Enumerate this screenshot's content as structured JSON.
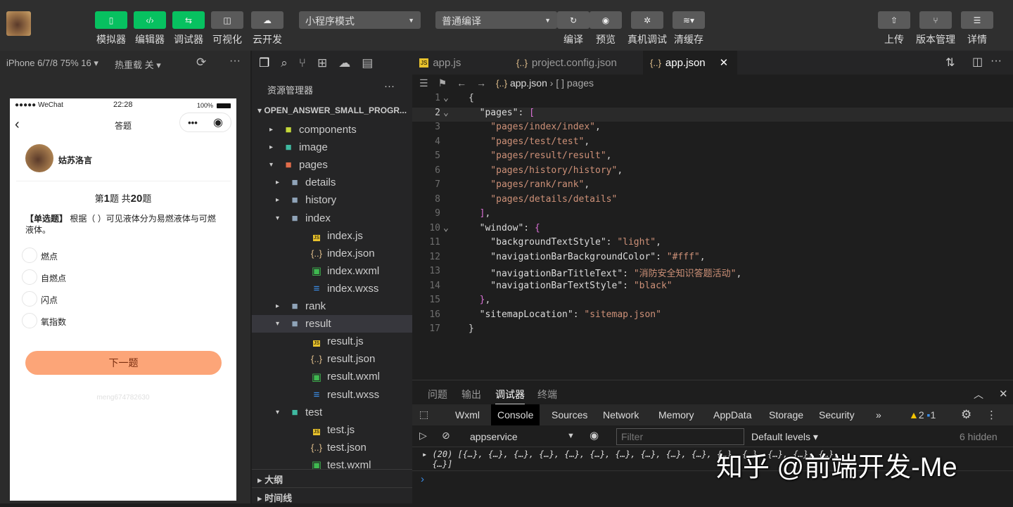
{
  "toolbar": {
    "buttons": [
      {
        "label": "模拟器",
        "icon": "phone-icon"
      },
      {
        "label": "编辑器",
        "icon": "code-icon"
      },
      {
        "label": "调试器",
        "icon": "sliders-icon"
      },
      {
        "label": "可视化",
        "icon": "layout-icon"
      },
      {
        "label": "云开发",
        "icon": "cloud-icon"
      }
    ],
    "mode_select": "小程序模式",
    "compile_select": "普通编译",
    "actions": [
      {
        "label": "编译",
        "icon": "refresh-icon"
      },
      {
        "label": "预览",
        "icon": "eye-icon"
      },
      {
        "label": "真机调试",
        "icon": "bug-icon"
      },
      {
        "label": "清缓存",
        "icon": "layers-icon"
      }
    ],
    "right": [
      {
        "label": "上传",
        "icon": "upload-icon"
      },
      {
        "label": "版本管理",
        "icon": "branch-icon"
      },
      {
        "label": "详情",
        "icon": "menu-icon"
      }
    ],
    "accent": "#07c160"
  },
  "simulator": {
    "device": "iPhone 6/7/8 75% 16 ▾",
    "hot_reload": "热重载 关 ▾",
    "status": {
      "carrier": "●●●●● WeChat",
      "time": "22:28",
      "battery": "100%"
    },
    "nav_title": "答题",
    "user_name": "姑苏洛言",
    "progress_prefix": "第",
    "current": "1",
    "mid": "题 共",
    "total": "20",
    "suffix": "题",
    "question_type": "【单选题】",
    "question": "根据（ ）可见液体分为易燃液体与可燃液体。",
    "options": [
      "燃点",
      "自燃点",
      "闪点",
      "氧指数"
    ],
    "next_button": "下一题",
    "button_color": "#fca578",
    "watermark": "meng674782630"
  },
  "explorer": {
    "title": "资源管理器",
    "project": "OPEN_ANSWER_SMALL_PROGR...",
    "items": [
      {
        "label": "components",
        "type": "folder",
        "depth": 1,
        "open": false
      },
      {
        "label": "image",
        "type": "folder",
        "depth": 1,
        "open": false
      },
      {
        "label": "pages",
        "type": "folder",
        "depth": 1,
        "open": true
      },
      {
        "label": "details",
        "type": "folder",
        "depth": 2,
        "open": false
      },
      {
        "label": "history",
        "type": "folder",
        "depth": 2,
        "open": false
      },
      {
        "label": "index",
        "type": "folder",
        "depth": 2,
        "open": true
      },
      {
        "label": "index.js",
        "type": "js",
        "depth": 3
      },
      {
        "label": "index.json",
        "type": "json",
        "depth": 3
      },
      {
        "label": "index.wxml",
        "type": "wxml",
        "depth": 3
      },
      {
        "label": "index.wxss",
        "type": "wxss",
        "depth": 3
      },
      {
        "label": "rank",
        "type": "folder",
        "depth": 2,
        "open": false
      },
      {
        "label": "result",
        "type": "folder",
        "depth": 2,
        "open": true,
        "selected": true
      },
      {
        "label": "result.js",
        "type": "js",
        "depth": 3
      },
      {
        "label": "result.json",
        "type": "json",
        "depth": 3
      },
      {
        "label": "result.wxml",
        "type": "wxml",
        "depth": 3
      },
      {
        "label": "result.wxss",
        "type": "wxss",
        "depth": 3
      },
      {
        "label": "test",
        "type": "folder",
        "depth": 2,
        "open": true
      },
      {
        "label": "test.js",
        "type": "js",
        "depth": 3
      },
      {
        "label": "test.json",
        "type": "json",
        "depth": 3
      },
      {
        "label": "test.wxml",
        "type": "wxml",
        "depth": 3
      }
    ],
    "outline": "大纲",
    "timeline": "时间线"
  },
  "editor": {
    "tabs": [
      {
        "label": "app.js",
        "icon": "js"
      },
      {
        "label": "project.config.json",
        "icon": "json"
      },
      {
        "label": "app.json",
        "icon": "json",
        "active": true
      }
    ],
    "breadcrumb": [
      "app.json",
      "[ ] pages"
    ],
    "lines": [
      [
        [
          "p",
          "{"
        ]
      ],
      [
        [
          "k",
          "  \"pages\""
        ],
        [
          "p",
          ": "
        ],
        [
          "b2",
          "["
        ]
      ],
      [
        [
          "s",
          "    \"pages/index/index\""
        ],
        [
          "p",
          ","
        ]
      ],
      [
        [
          "s",
          "    \"pages/test/test\""
        ],
        [
          "p",
          ","
        ]
      ],
      [
        [
          "s",
          "    \"pages/result/result\""
        ],
        [
          "p",
          ","
        ]
      ],
      [
        [
          "s",
          "    \"pages/history/history\""
        ],
        [
          "p",
          ","
        ]
      ],
      [
        [
          "s",
          "    \"pages/rank/rank\""
        ],
        [
          "p",
          ","
        ]
      ],
      [
        [
          "s",
          "    \"pages/details/details\""
        ]
      ],
      [
        [
          "b2",
          "  ]"
        ],
        [
          "p",
          ","
        ]
      ],
      [
        [
          "k",
          "  \"window\""
        ],
        [
          "p",
          ": "
        ],
        [
          "b2",
          "{"
        ]
      ],
      [
        [
          "k",
          "    \"backgroundTextStyle\""
        ],
        [
          "p",
          ": "
        ],
        [
          "s",
          "\"light\""
        ],
        [
          "p",
          ","
        ]
      ],
      [
        [
          "k",
          "    \"navigationBarBackgroundColor\""
        ],
        [
          "p",
          ": "
        ],
        [
          "s",
          "\"#fff\""
        ],
        [
          "p",
          ","
        ]
      ],
      [
        [
          "k",
          "    \"navigationBarTitleText\""
        ],
        [
          "p",
          ": "
        ],
        [
          "s",
          "\"消防安全知识答题活动\""
        ],
        [
          "p",
          ","
        ]
      ],
      [
        [
          "k",
          "    \"navigationBarTextStyle\""
        ],
        [
          "p",
          ": "
        ],
        [
          "s",
          "\"black\""
        ]
      ],
      [
        [
          "b2",
          "  }"
        ],
        [
          "p",
          ","
        ]
      ],
      [
        [
          "k",
          "  \"sitemapLocation\""
        ],
        [
          "p",
          ": "
        ],
        [
          "s",
          "\"sitemap.json\""
        ]
      ],
      [
        [
          "p",
          "}"
        ]
      ]
    ]
  },
  "debugger": {
    "panel_tabs": [
      "问题",
      "输出",
      "调试器",
      "终端"
    ],
    "active_panel": "调试器",
    "tabs": [
      "Wxml",
      "Console",
      "Sources",
      "Network",
      "Memory",
      "AppData",
      "Storage",
      "Security",
      "»"
    ],
    "active_tab": "Console",
    "warnings": "2",
    "messages": "1",
    "context": "appservice",
    "filter_placeholder": "Filter",
    "levels": "Default levels ▾",
    "hidden": "6 hidden",
    "log_line1": "(20) [{…}, {…}, {…}, {…}, {…}, {…}, {…}, {…}, {…}, {…}, {…}, {…}, {…}, {…}, {…},",
    "log_line2": "{…}]",
    "prompt": "›"
  },
  "watermark": "知乎 @前端开发-Me"
}
